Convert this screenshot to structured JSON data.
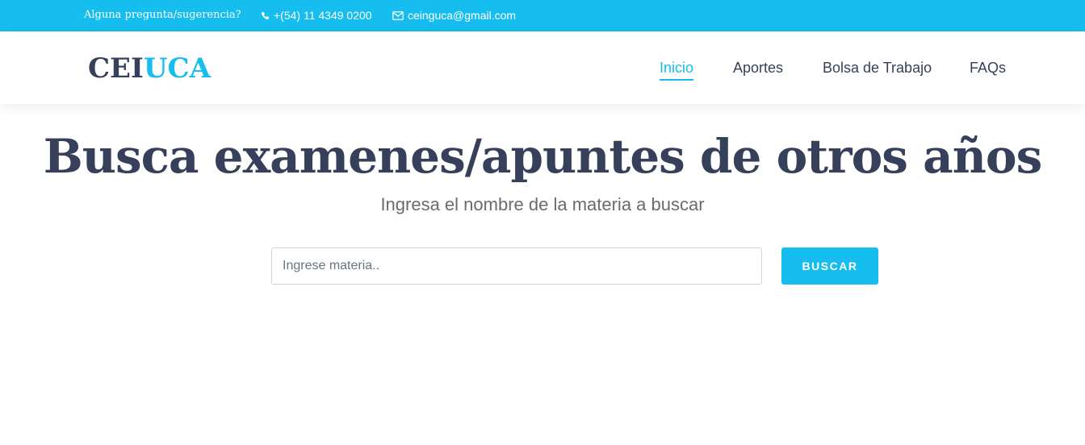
{
  "topbar": {
    "question": "Alguna pregunta/sugerencia?",
    "phone": "+(54) 11 4349 0200",
    "email": "ceinguca@gmail.com",
    "phone_icon": "phone-icon",
    "email_icon": "envelope-icon"
  },
  "header": {
    "logo_part1": "CEI",
    "logo_part2": "UCA",
    "nav": [
      {
        "label": "Inicio",
        "active": true
      },
      {
        "label": "Aportes",
        "active": false
      },
      {
        "label": "Bolsa de Trabajo",
        "active": false
      },
      {
        "label": "FAQs",
        "active": false
      }
    ]
  },
  "hero": {
    "title": "Busca examenes/apuntes de otros años",
    "subtitle": "Ingresa el nombre de la materia a buscar"
  },
  "search": {
    "placeholder": "Ingrese materia..",
    "value": "",
    "button_label": "BUSCAR"
  },
  "colors": {
    "accent": "#16bdef",
    "text_dark": "#37405a",
    "text_muted": "#6b6b6b"
  }
}
